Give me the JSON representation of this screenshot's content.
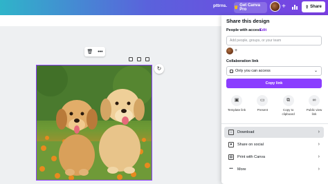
{
  "header": {
    "title": "pttrns.",
    "pro_button": "Get Canva Pro",
    "share_button": "Share",
    "icons": [
      "crown-icon",
      "plus-icon",
      "analytics-icon",
      "upload-icon"
    ]
  },
  "canvas": {
    "image_subject": "two golden retriever puppies in flowers"
  },
  "share_panel": {
    "title": "Share this design",
    "people_label": "People with access",
    "edit_label": "Edit",
    "add_placeholder": "Add people, groups, or your team",
    "collab_label": "Collaboration link",
    "access_value": "Only you can access",
    "copy_link": "Copy link",
    "actions": [
      {
        "label": "Template link",
        "icon": "template-icon"
      },
      {
        "label": "Present",
        "icon": "present-icon"
      },
      {
        "label": "Copy to clipboard",
        "icon": "copy-icon"
      },
      {
        "label": "Public view link",
        "icon": "link-icon"
      }
    ],
    "options": [
      {
        "label": "Download",
        "icon": "download-icon"
      },
      {
        "label": "Share on social",
        "icon": "social-icon"
      },
      {
        "label": "Print with Canva",
        "icon": "print-icon"
      },
      {
        "label": "More",
        "icon": "more-icon"
      }
    ]
  },
  "colors": {
    "accent": "#8b3dff",
    "header_gradient_start": "#2fb4c9",
    "header_gradient_end": "#7b3fe4"
  }
}
